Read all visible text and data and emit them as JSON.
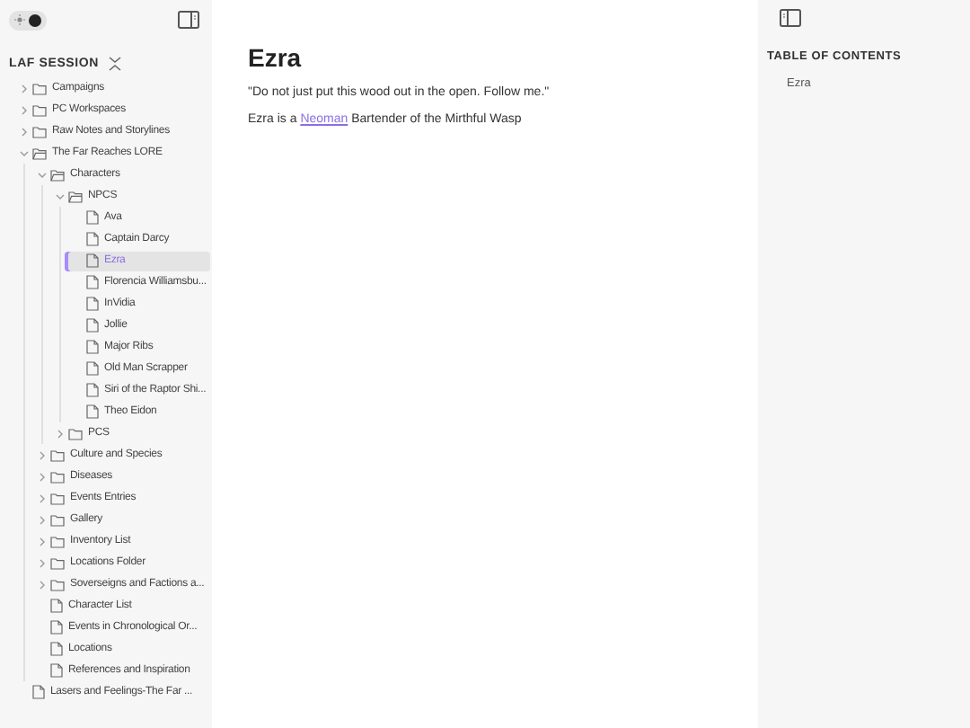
{
  "sidebar": {
    "theme_toggle": {
      "dark": true
    },
    "vault_title": "LAF SESSION",
    "tree": [
      {
        "kind": "folder",
        "label": "Campaigns",
        "expanded": false
      },
      {
        "kind": "folder",
        "label": "PC Workspaces",
        "expanded": false
      },
      {
        "kind": "folder",
        "label": "Raw Notes and Storylines",
        "expanded": false
      },
      {
        "kind": "folder",
        "label": "The Far Reaches LORE",
        "expanded": true,
        "children": [
          {
            "kind": "folder",
            "label": "Characters",
            "expanded": true,
            "children": [
              {
                "kind": "folder",
                "label": "NPCS",
                "expanded": true,
                "children": [
                  {
                    "kind": "file",
                    "label": "Ava",
                    "selected": false
                  },
                  {
                    "kind": "file",
                    "label": "Captain Darcy",
                    "selected": false
                  },
                  {
                    "kind": "file",
                    "label": "Ezra",
                    "selected": true
                  },
                  {
                    "kind": "file",
                    "label": "Florencia Williamsbu...",
                    "selected": false
                  },
                  {
                    "kind": "file",
                    "label": "InVidia",
                    "selected": false
                  },
                  {
                    "kind": "file",
                    "label": "Jollie",
                    "selected": false
                  },
                  {
                    "kind": "file",
                    "label": "Major Ribs",
                    "selected": false
                  },
                  {
                    "kind": "file",
                    "label": "Old Man Scrapper",
                    "selected": false
                  },
                  {
                    "kind": "file",
                    "label": "Siri of the Raptor Shi...",
                    "selected": false
                  },
                  {
                    "kind": "file",
                    "label": "Theo Eidon",
                    "selected": false
                  }
                ]
              },
              {
                "kind": "folder",
                "label": "PCS",
                "expanded": false
              }
            ]
          },
          {
            "kind": "folder",
            "label": "Culture and Species",
            "expanded": false
          },
          {
            "kind": "folder",
            "label": "Diseases",
            "expanded": false
          },
          {
            "kind": "folder",
            "label": "Events Entries",
            "expanded": false
          },
          {
            "kind": "folder",
            "label": "Gallery",
            "expanded": false
          },
          {
            "kind": "folder",
            "label": "Inventory List",
            "expanded": false
          },
          {
            "kind": "folder",
            "label": "Locations Folder",
            "expanded": false
          },
          {
            "kind": "folder",
            "label": "Soverseigns and Factions a...",
            "expanded": false
          },
          {
            "kind": "file",
            "label": "Character List",
            "selected": false
          },
          {
            "kind": "file",
            "label": "Events in Chronological Or...",
            "selected": false
          },
          {
            "kind": "file",
            "label": "Locations",
            "selected": false
          },
          {
            "kind": "file",
            "label": "References and Inspiration",
            "selected": false
          }
        ]
      },
      {
        "kind": "file",
        "label": "Lasers and Feelings-The Far ...",
        "selected": false
      }
    ]
  },
  "page": {
    "title": "Ezra",
    "quote": "\"Do not just put this wood out in the open. Follow me.\"",
    "sentence": {
      "before": "Ezra is a ",
      "link": "Neoman",
      "after": " Bartender of the Mirthful Wasp"
    }
  },
  "toc": {
    "heading": "TABLE OF CONTENTS",
    "items": [
      "Ezra"
    ]
  }
}
